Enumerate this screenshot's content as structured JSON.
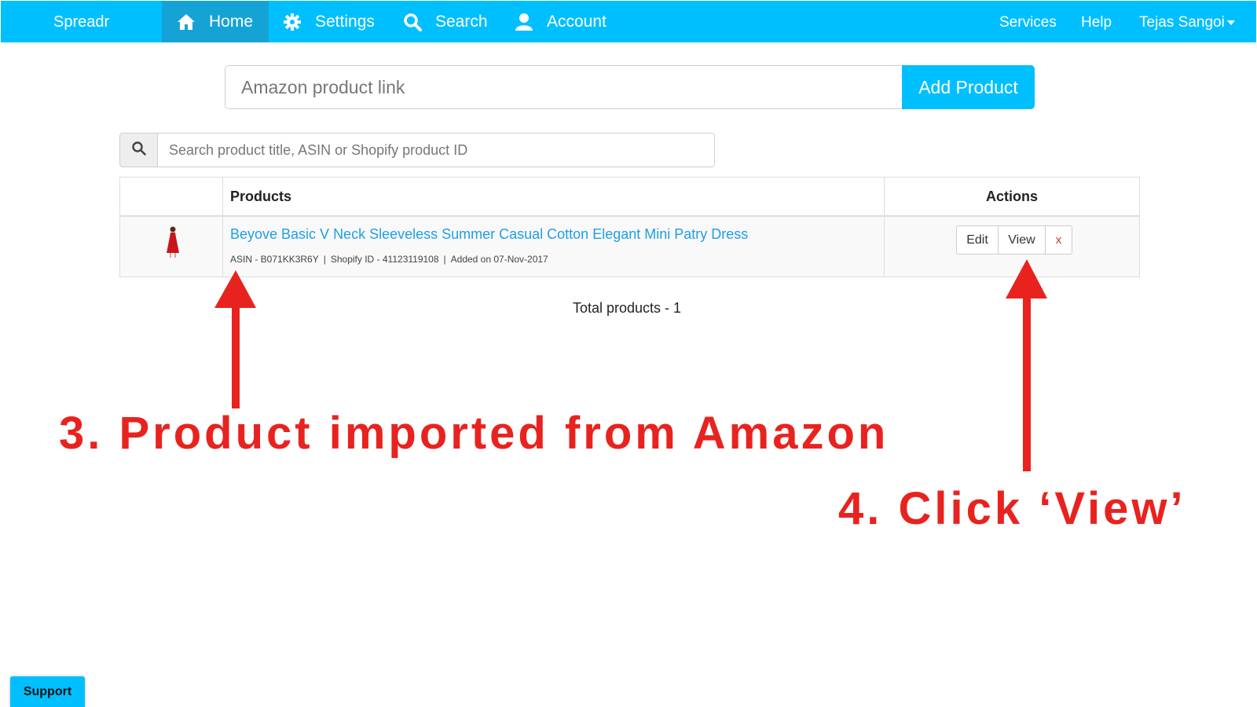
{
  "navbar": {
    "brand": "Spreadr",
    "items": [
      {
        "label": "Home",
        "icon": "home-icon",
        "active": true
      },
      {
        "label": "Settings",
        "icon": "gear-icon"
      },
      {
        "label": "Search",
        "icon": "search-icon"
      },
      {
        "label": "Account",
        "icon": "user-icon"
      }
    ],
    "right": {
      "services": "Services",
      "help": "Help",
      "user": "Tejas Sangoi"
    }
  },
  "add_form": {
    "placeholder": "Amazon product link",
    "button": "Add Product"
  },
  "search": {
    "placeholder": "Search product title, ASIN or Shopify product ID"
  },
  "table": {
    "headers": {
      "products": "Products",
      "actions": "Actions"
    },
    "rows": [
      {
        "title": "Beyove Basic V Neck Sleeveless Summer Casual Cotton Elegant Mini Patry Dress",
        "asin": "ASIN - B071KK3R6Y",
        "shopify_id": "Shopify ID - 41123119108",
        "added": "Added on 07-Nov-2017",
        "actions": {
          "edit": "Edit",
          "view": "View",
          "delete": "x"
        }
      }
    ]
  },
  "total": "Total products - 1",
  "annotations": {
    "step3": "3. Product imported from Amazon",
    "step4": "4. Click ‘View’"
  },
  "support": "Support",
  "colors": {
    "brand": "#00bfff",
    "active_nav": "#15a3d6",
    "annotation": "#e8231f",
    "link": "#1e9ee6"
  }
}
